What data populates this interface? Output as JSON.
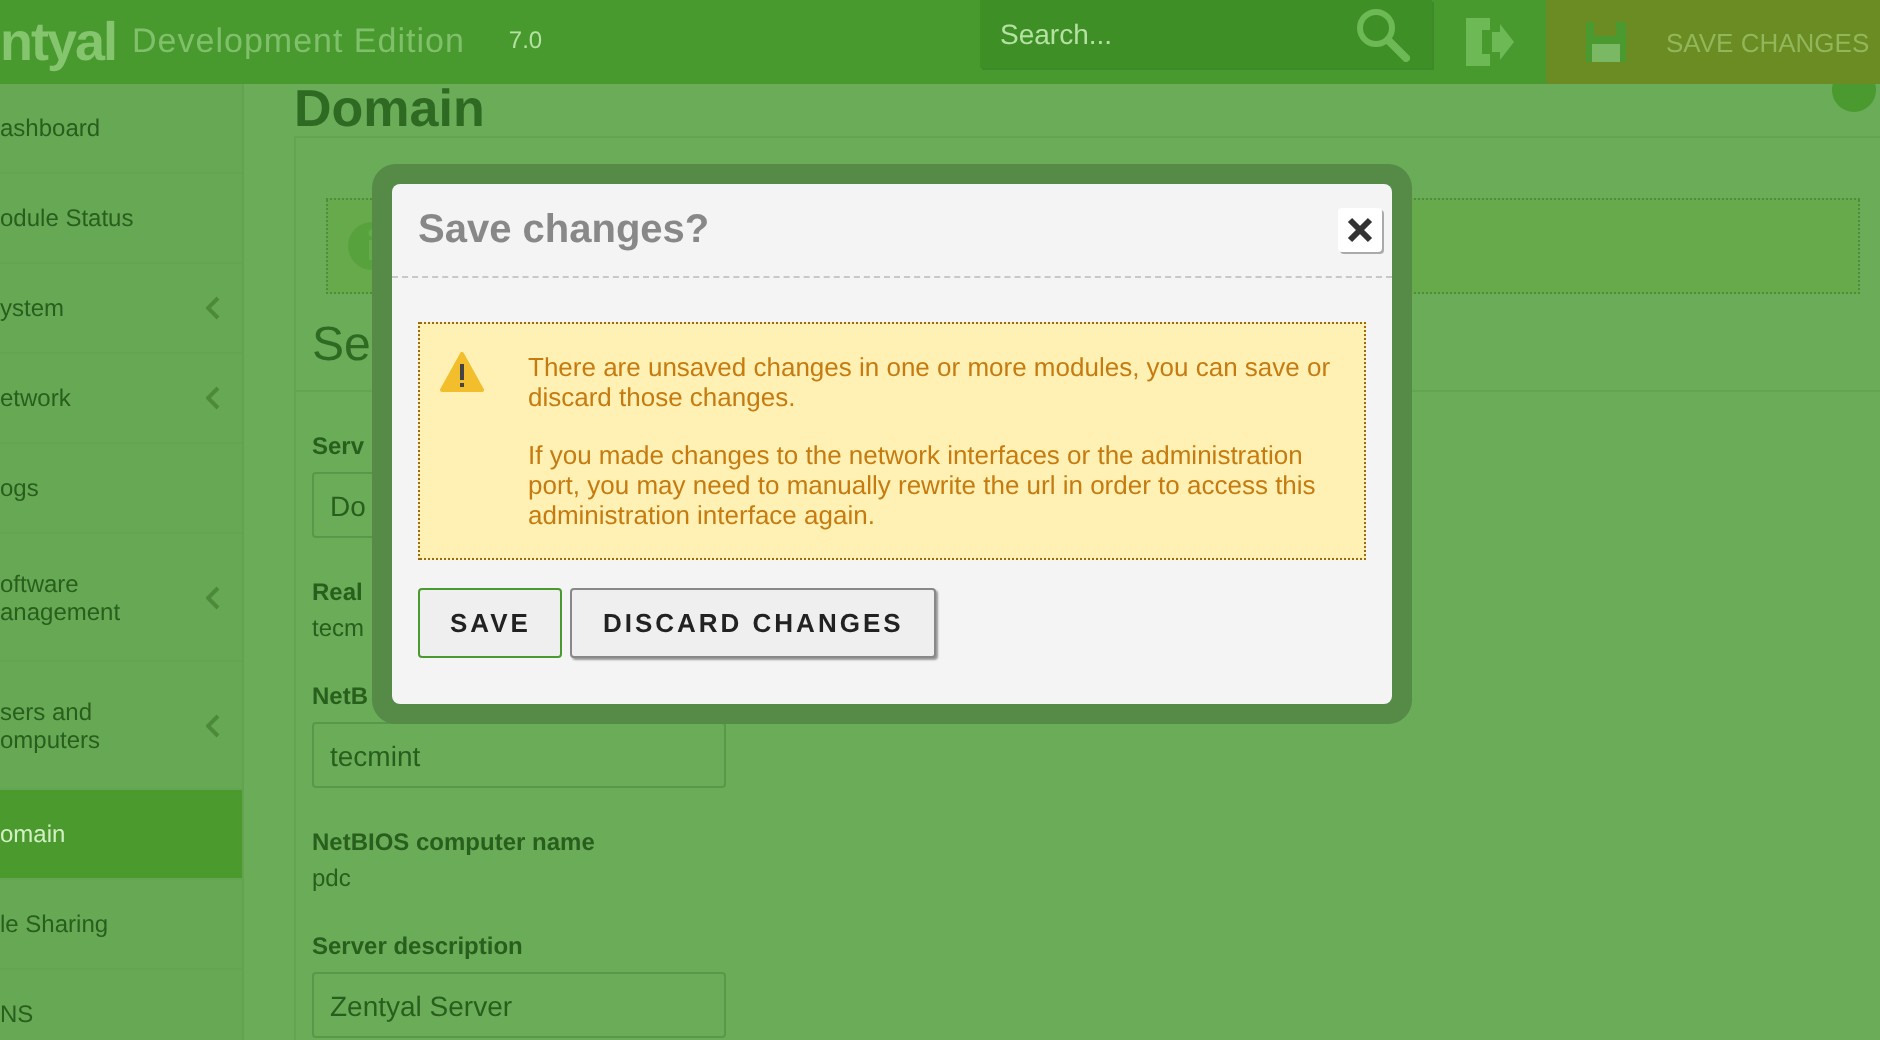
{
  "header": {
    "logo": "ntyal",
    "edition": "Development Edition",
    "version": "7.0",
    "search": {
      "placeholder": "Search..."
    },
    "save_changes": "SAVE CHANGES"
  },
  "sidebar": {
    "items": [
      {
        "label": "ashboard",
        "selected": false,
        "expandable": false
      },
      {
        "label": "odule Status",
        "selected": false,
        "expandable": false
      },
      {
        "label": "ystem",
        "selected": false,
        "expandable": true
      },
      {
        "label": "etwork",
        "selected": false,
        "expandable": true
      },
      {
        "label": "ogs",
        "selected": false,
        "expandable": false
      },
      {
        "label": "oftware anagement",
        "selected": false,
        "expandable": true
      },
      {
        "label": "sers and omputers",
        "selected": false,
        "expandable": true
      },
      {
        "label": "omain",
        "selected": true,
        "expandable": false
      },
      {
        "label": "le Sharing",
        "selected": false,
        "expandable": false
      },
      {
        "label": "NS",
        "selected": false,
        "expandable": false
      }
    ]
  },
  "content": {
    "title": "Domain",
    "section": "Se",
    "fields": [
      {
        "kind": "input",
        "label": "Serv",
        "value": "Do"
      },
      {
        "kind": "text",
        "label": "Real",
        "value": "tecm"
      },
      {
        "kind": "input",
        "label": "NetB",
        "value": "tecmint"
      },
      {
        "kind": "text",
        "label": "NetBIOS computer name",
        "value": "pdc"
      },
      {
        "kind": "input",
        "label": "Server description",
        "value": "Zentyal Server"
      }
    ]
  },
  "dialog": {
    "title": "Save changes?",
    "messages": [
      "There are unsaved changes in one or more modules, you can save or discard those changes.",
      "If you made changes to the network interfaces or the administration port, you may need to manually rewrite the url in order to access this administration interface again."
    ],
    "buttons": [
      {
        "label": "SAVE",
        "focused": true
      },
      {
        "label": "DISCARD CHANGES",
        "focused": false
      }
    ]
  }
}
